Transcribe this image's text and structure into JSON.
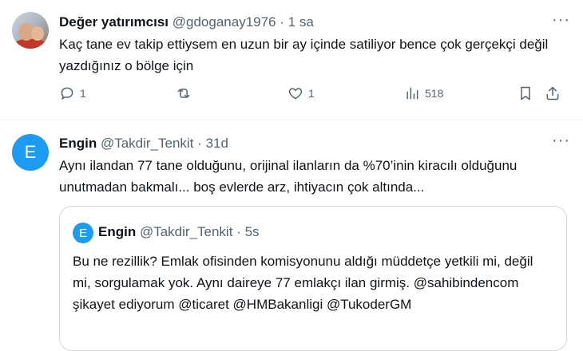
{
  "tweet1": {
    "avatar_icon": "profile-photo",
    "name": "Değer yatırımcısı",
    "handle": "@gdoganay1976",
    "dot": "·",
    "time": "1 sa",
    "more_icon": "more-dots-icon",
    "text": "Kaç tane ev takip ettiysem en uzun bir ay içinde satiliyor bence çok gerçekçi değil yazdığınız o bölge için",
    "actions": {
      "reply_count": "1",
      "retweet_count": "",
      "like_count": "1",
      "views_count": "518"
    }
  },
  "tweet2": {
    "avatar_letter": "E",
    "name": "Engin",
    "handle": "@Takdir_Tenkit",
    "dot": "·",
    "time": "31d",
    "more_icon": "more-dots-icon",
    "text": "Aynı ilandan 77 tane olduğunu, orijinal ilanların da %70’inin kiracılı olduğunu unutmadan bakmalı... boş evlerde arz, ihtiyacın çok altında...",
    "quote": {
      "avatar_letter": "E",
      "name": "Engin",
      "handle": "@Takdir_Tenkit",
      "dot": "·",
      "time": "5s",
      "text": "Bu ne rezillik? Emlak ofisinden komisyonunu aldığı müddetçe yetkili mi, değil mi, sorgulamak yok. Aynı daireye 77 emlakçı ilan girmiş. @sahibindencom şikayet ediyorum @ticaret @HMBakanligi @TukoderGM"
    }
  },
  "colors": {
    "text_primary": "#0f1419",
    "text_secondary": "#536471",
    "accent": "#1d9bf0",
    "border": "#cfd9de"
  }
}
